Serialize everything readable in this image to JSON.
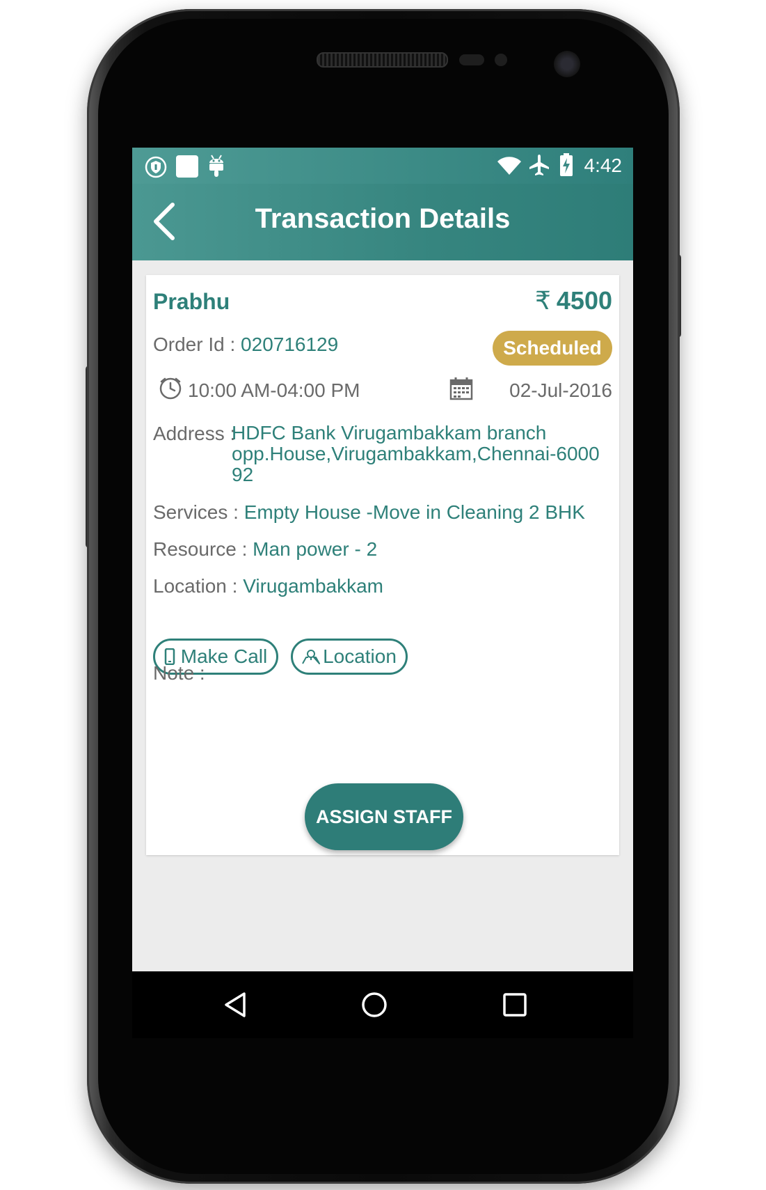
{
  "status_bar": {
    "time": "4:42",
    "left_icons": [
      "shield-icon",
      "square-notification-icon",
      "android-icon"
    ],
    "right_icons": [
      "wifi-icon",
      "airplane-icon",
      "battery-charging-icon"
    ]
  },
  "toolbar": {
    "title": "Transaction Details",
    "back_icon": "chevron-left-icon"
  },
  "transaction": {
    "customer_name": "Prabhu",
    "currency_symbol": "₹",
    "amount": "4500",
    "order_label": "Order Id : ",
    "order_id": "020716129",
    "status": "Scheduled",
    "time_range": "10:00 AM-04:00 PM",
    "date": "02-Jul-2016",
    "address_label": "Address : ",
    "address_line1": "HDFC Bank  Virugambakkam branch",
    "address_line2": "opp.House,Virugambakkam,Chennai-6000",
    "address_line3": "92",
    "services_label": "Services : ",
    "services": "Empty House -Move in Cleaning 2 BHK",
    "resource_label": "Resource : ",
    "resource": "Man power - 2",
    "location_label": "Location : ",
    "location": "Virugambakkam",
    "note_label": "Note :"
  },
  "actions": {
    "make_call": "Make Call",
    "location": "Location",
    "assign_staff": "ASSIGN STAFF"
  },
  "colors": {
    "primary": "#2e8079",
    "badge": "#ceaa4b",
    "label_grey": "#6a6a6a",
    "background": "#ececec"
  }
}
